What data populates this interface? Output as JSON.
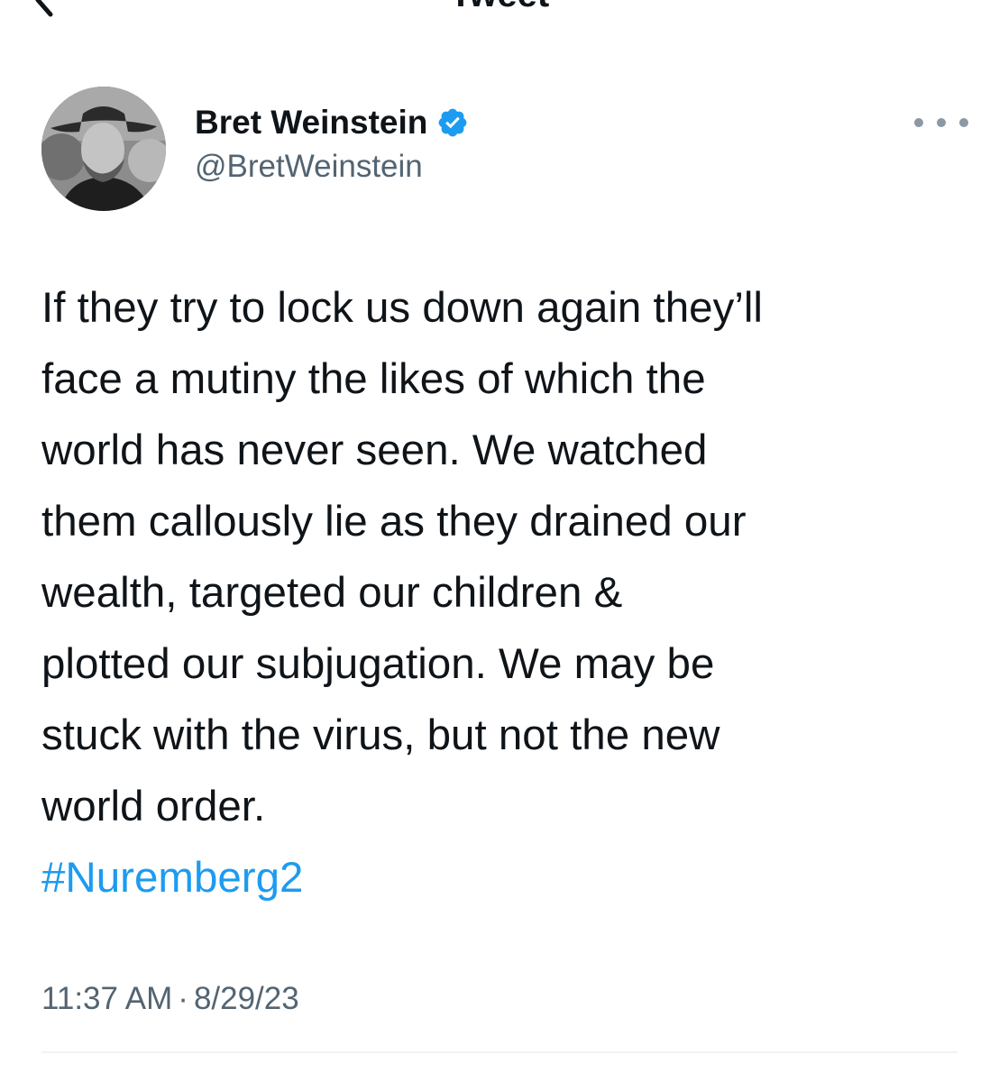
{
  "header": {
    "title": "Tweet",
    "back_icon": "chevron-left-icon"
  },
  "author": {
    "display_name": "Bret Weinstein",
    "handle": "@BretWeinstein",
    "verified": true,
    "verified_icon": "verified-badge-icon",
    "more_icon": "more-horizontal-icon"
  },
  "tweet": {
    "lines": [
      "If they try to lock us down again they’ll",
      "face a mutiny the likes of which the",
      "world has never seen. We watched",
      "them callously lie as they drained our",
      "wealth, targeted our children &",
      "plotted our subjugation. We may be",
      "stuck with the virus, but not the new",
      "world order."
    ],
    "hashtag": "#Nuremberg2"
  },
  "meta": {
    "time": "11:37 AM",
    "separator": "·",
    "date": "8/29/23"
  },
  "colors": {
    "text_primary": "#0f1419",
    "text_secondary": "#536471",
    "accent": "#1d9bf0",
    "divider": "#eff3f4"
  }
}
